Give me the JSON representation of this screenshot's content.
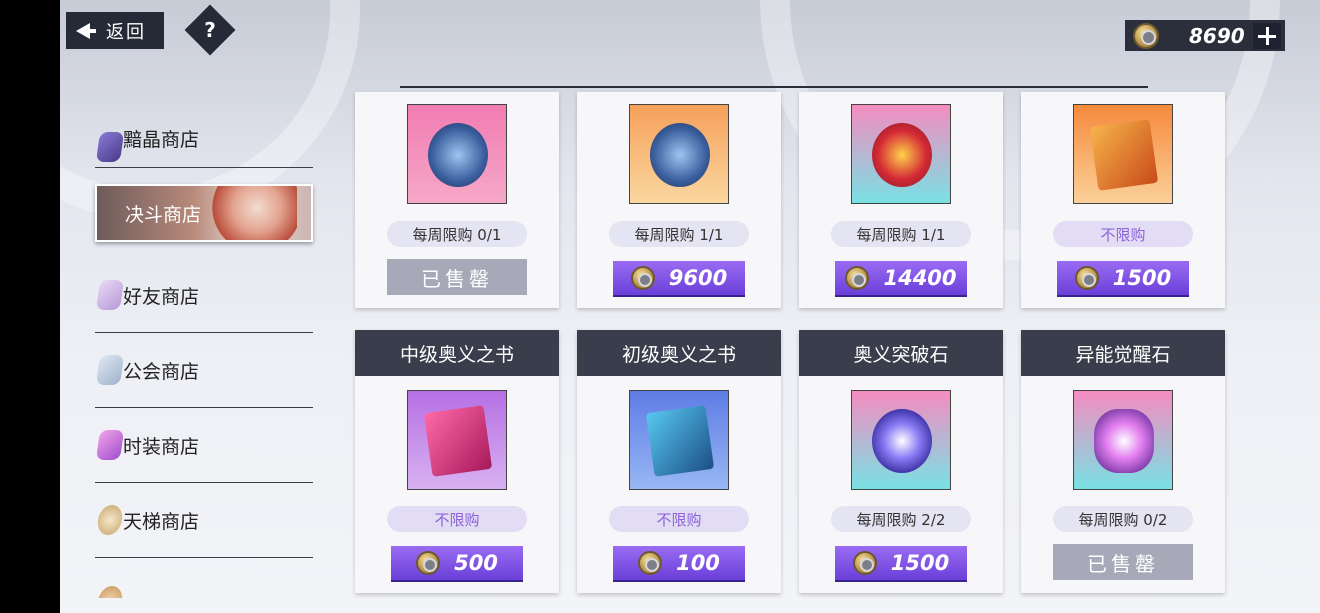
{
  "header": {
    "back_label": "返回",
    "help_label": "?",
    "currency_amount": "8690"
  },
  "sidebar": {
    "items": [
      {
        "label": "黯晶商店",
        "icon": "crystal-icon",
        "active": false
      },
      {
        "label": "决斗商店",
        "icon": "character-portrait",
        "active": true
      },
      {
        "label": "好友商店",
        "icon": "friend-icon",
        "active": false
      },
      {
        "label": "公会商店",
        "icon": "guild-icon",
        "active": false
      },
      {
        "label": "时装商店",
        "icon": "fashion-icon",
        "active": false
      },
      {
        "label": "天梯商店",
        "icon": "ladder-icon",
        "active": false
      }
    ]
  },
  "shop": {
    "row1": [
      {
        "limit": "每周限购 0/1",
        "price": "",
        "sold": "已售罄",
        "thumb": "badge-blue-pink"
      },
      {
        "limit": "每周限购 1/1",
        "price": "9600",
        "sold": "",
        "thumb": "badge-blue-orange"
      },
      {
        "limit": "每周限购 1/1",
        "price": "14400",
        "sold": "",
        "thumb": "badge-red"
      },
      {
        "limit": "不限购",
        "price": "1500",
        "sold": "",
        "thumb": "book-orange"
      }
    ],
    "row2": [
      {
        "title": "中级奥义之书",
        "limit": "不限购",
        "price": "500",
        "sold": "",
        "thumb": "book-pink"
      },
      {
        "title": "初级奥义之书",
        "limit": "不限购",
        "price": "100",
        "sold": "",
        "thumb": "book-teal"
      },
      {
        "title": "奥义突破石",
        "limit": "每周限购 2/2",
        "price": "1500",
        "sold": "",
        "thumb": "gem-blue"
      },
      {
        "title": "异能觉醒石",
        "limit": "每周限购 0/2",
        "price": "",
        "sold": "已售罄",
        "thumb": "gem-pink"
      }
    ]
  },
  "colors": {
    "accent": "#7a4fe3",
    "dark_bar": "#3a3e4c",
    "sold_out": "#a8a9b8"
  }
}
